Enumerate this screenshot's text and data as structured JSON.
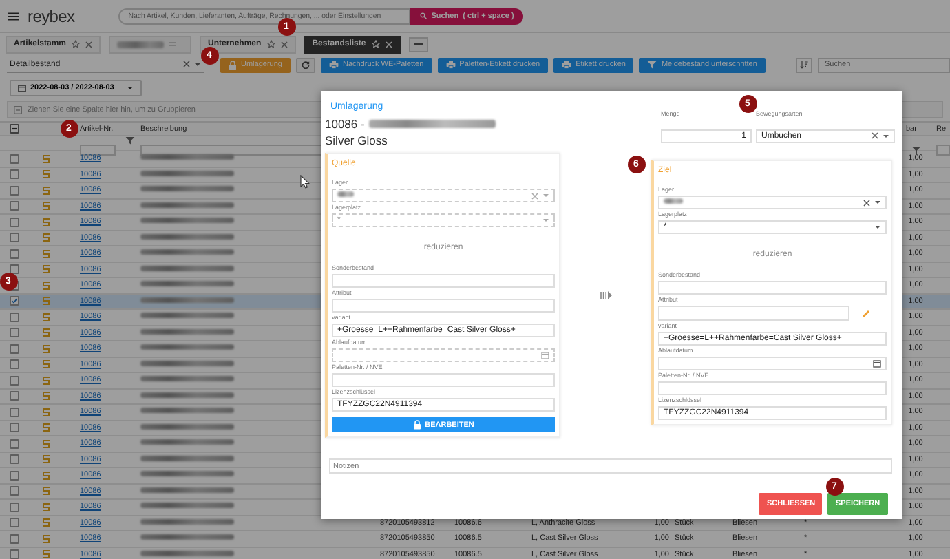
{
  "header": {
    "logo": "reybex",
    "search": {
      "placeholder": "Nach Artikel, Kunden, Lieferanten, Aufträge, Rechnungen, ... oder Einstellungen"
    },
    "search_button": "Suchen  ( ctrl + space )"
  },
  "tabs": [
    {
      "label": "Artikelstamm",
      "selected": false,
      "kind": "tab"
    },
    {
      "selected": false,
      "kind": "redacted"
    },
    {
      "label": "Unternehmen",
      "selected": false,
      "kind": "tab"
    },
    {
      "label": "Bestandsliste",
      "selected": true,
      "kind": "tab"
    }
  ],
  "toolbar": {
    "view_select": "Detailbestand",
    "buttons": [
      {
        "label": "Umlagerung",
        "kind": "warning"
      },
      {
        "kind": "refresh"
      },
      {
        "label": "Nachdruck WE-Paletten",
        "kind": "print"
      },
      {
        "label": "Paletten-Etikett drucken",
        "kind": "print"
      },
      {
        "label": "Etikett drucken",
        "kind": "print"
      },
      {
        "label": "Meldebestand unterschritten",
        "kind": "filter"
      }
    ],
    "search": {
      "placeholder": "Suchen"
    }
  },
  "date_range": "2022-08-03 / 2022-08-03",
  "group_panel": "Ziehen Sie eine Spalte hier hin, um zu Gruppieren",
  "select_all": {
    "indeterminate": true
  },
  "columns": [
    {
      "label": "Artikel-Nr."
    },
    {
      "label": "Beschreibung"
    },
    {
      "label": "bar"
    },
    {
      "label": "Re"
    }
  ],
  "rows": [
    {
      "selected": false,
      "article_no": "10086",
      "available": "1,00"
    },
    {
      "selected": false,
      "article_no": "10086",
      "available": "1,00"
    },
    {
      "selected": false,
      "article_no": "10086",
      "available": "1,00"
    },
    {
      "selected": false,
      "article_no": "10086",
      "available": "1,00"
    },
    {
      "selected": false,
      "article_no": "10086",
      "available": "1,00"
    },
    {
      "selected": false,
      "article_no": "10086",
      "available": "1,00"
    },
    {
      "selected": false,
      "article_no": "10086",
      "available": "1,00"
    },
    {
      "selected": false,
      "article_no": "10086",
      "available": "1,00"
    },
    {
      "selected": false,
      "article_no": "10086",
      "available": "1,00"
    },
    {
      "selected": true,
      "article_no": "10086",
      "available": "1,00"
    },
    {
      "selected": false,
      "article_no": "10086",
      "available": "1,00"
    },
    {
      "selected": false,
      "article_no": "10086",
      "available": "1,00"
    },
    {
      "selected": false,
      "article_no": "10086",
      "available": "1,00"
    },
    {
      "selected": false,
      "article_no": "10086",
      "available": "1,00"
    },
    {
      "selected": false,
      "article_no": "10086",
      "available": "1,00"
    },
    {
      "selected": false,
      "article_no": "10086",
      "available": "1,00"
    },
    {
      "selected": false,
      "article_no": "10086",
      "available": "1,00"
    },
    {
      "selected": false,
      "article_no": "10086",
      "available": "1,00"
    },
    {
      "selected": false,
      "article_no": "10086",
      "available": "1,00"
    },
    {
      "selected": false,
      "article_no": "10086",
      "available": "1,00"
    },
    {
      "selected": false,
      "article_no": "10086",
      "available": "1,00"
    },
    {
      "selected": false,
      "article_no": "10086",
      "available": "1,00"
    },
    {
      "selected": false,
      "article_no": "10086",
      "available": "1,00"
    },
    {
      "selected": false,
      "article_no": "10086",
      "ean": "8720105493812",
      "variant_no": "10086.6",
      "variant": "L, Anthracite Gloss",
      "quantity": "1,00",
      "unit": "Stück",
      "warehouse": "Bliesen",
      "bin": "*",
      "available": "1,00"
    },
    {
      "selected": false,
      "article_no": "10086",
      "ean": "8720105493850",
      "variant_no": "10086.5",
      "variant": "L, Cast Silver Gloss",
      "quantity": "1,00",
      "unit": "Stück",
      "warehouse": "Bliesen",
      "bin": "*",
      "available": "1,00"
    },
    {
      "selected": false,
      "article_no": "10086",
      "ean": "8720105493850",
      "variant_no": "10086.5",
      "variant": "L, Cast Silver Gloss",
      "quantity": "1,00",
      "unit": "Stück",
      "warehouse": "Bliesen",
      "bin": "*",
      "available": "1,00"
    }
  ],
  "dialog": {
    "title": "Umlagerung",
    "article": "10086 -",
    "article_line2": "Silver Gloss",
    "quantity": {
      "label": "Menge",
      "value": "1"
    },
    "movement_type": {
      "label": "Bewegungsarten",
      "value": "Umbuchen"
    },
    "source": {
      "title": "Quelle",
      "disabled": true,
      "warehouse_label": "Lager",
      "bin_label": "Lagerplatz",
      "bin": "*",
      "reduce": "reduzieren",
      "fields": [
        {
          "label": "Sonderbestand",
          "kind": "text"
        },
        {
          "label": "Attribut",
          "kind": "text"
        },
        {
          "label": "variant",
          "value": "+Groesse=L++Rahmenfarbe=Cast Silver Gloss+",
          "kind": "text"
        },
        {
          "label": "Ablaufdatum",
          "kind": "date"
        },
        {
          "label": "Paletten-Nr. / NVE",
          "kind": "text"
        },
        {
          "label": "Lizenzschlüssel",
          "value": "TFYZZGC22N4911394",
          "kind": "text"
        }
      ],
      "edit_button": "BEARBEITEN"
    },
    "target": {
      "title": "Ziel",
      "disabled": false,
      "warehouse_label": "Lager",
      "bin_label": "Lagerplatz",
      "bin": "*",
      "reduce": "reduzieren",
      "fields": [
        {
          "label": "Sonderbestand",
          "kind": "text"
        },
        {
          "label": "Attribut",
          "kind": "editable"
        },
        {
          "label": "variant",
          "value": "+Groesse=L++Rahmenfarbe=Cast Silver Gloss+",
          "kind": "text"
        },
        {
          "label": "Ablaufdatum",
          "kind": "date"
        },
        {
          "label": "Paletten-Nr. / NVE",
          "kind": "text"
        },
        {
          "label": "Lizenzschlüssel",
          "value": "TFYZZGC22N4911394",
          "kind": "text"
        }
      ]
    },
    "notes": {
      "placeholder": "Notizen"
    },
    "buttons": [
      {
        "label": "SCHLIESSEN",
        "kind": "danger"
      },
      {
        "label": "SPEICHERN",
        "kind": "success"
      }
    ]
  },
  "annotations": [
    "1",
    "2",
    "3",
    "4",
    "5",
    "6",
    "7"
  ]
}
